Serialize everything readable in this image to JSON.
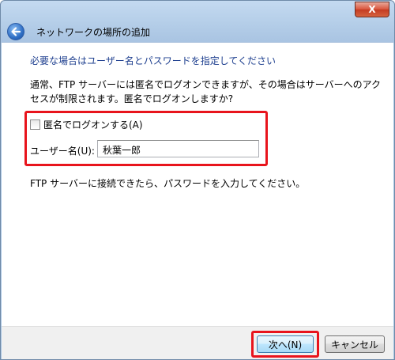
{
  "window": {
    "title": "ネットワークの場所の追加",
    "close_glyph": "X"
  },
  "main": {
    "heading": "必要な場合はユーザー名とパスワードを指定してください",
    "description": "通常、FTP サーバーには匿名でログオンできますが、その場合はサーバーへのアクセスが制限されます。匿名でログオンしますか?",
    "anonymous_checkbox": {
      "label": "匿名でログオンする(A)",
      "checked": false
    },
    "username": {
      "label": "ユーザー名(U):",
      "value": "秋葉一郎"
    },
    "note": "FTP サーバーに接続できたら、パスワードを入力してください。"
  },
  "footer": {
    "next_label": "次へ(N)",
    "cancel_label": "キャンセル"
  },
  "colors": {
    "highlight": "#e8141c",
    "heading": "#1e3f8f",
    "title_bar": "#b6cfe9"
  },
  "icons": {
    "back": "back-arrow-icon",
    "close": "close-icon"
  }
}
